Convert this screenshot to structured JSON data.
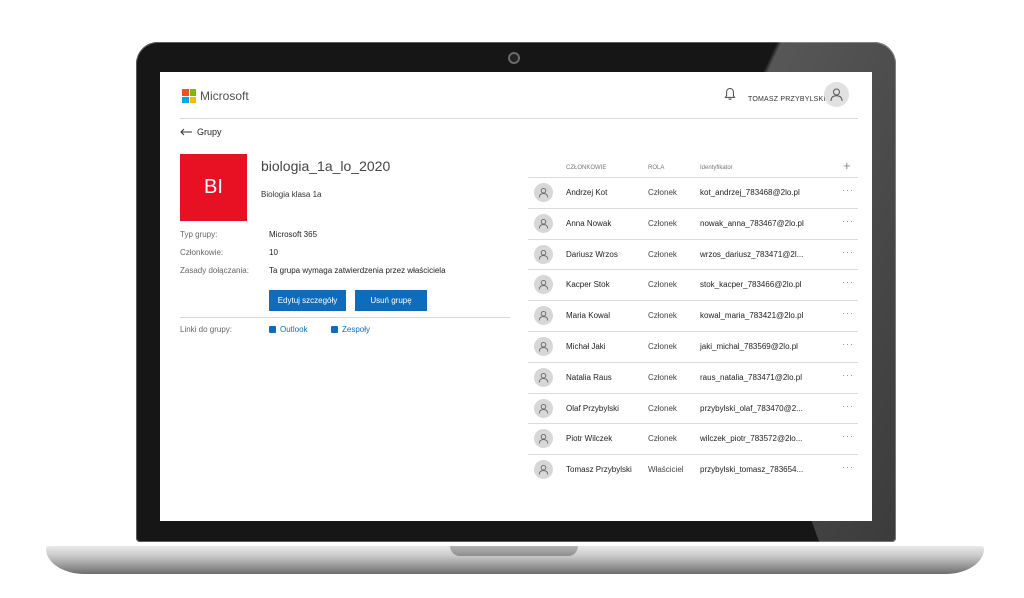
{
  "colors": {
    "accent": "#0f6cbd",
    "tile": "#e81123",
    "ms_red": "#f25022",
    "ms_green": "#7fba00",
    "ms_blue": "#00a4ef",
    "ms_yellow": "#ffb900"
  },
  "header": {
    "brand": "Microsoft",
    "user_name": "TOMASZ PRZYBYLSKI",
    "icons": [
      "bell-icon",
      "user-avatar-icon"
    ]
  },
  "back": {
    "label": "Grupy"
  },
  "group": {
    "initials": "BI",
    "name": "biologia_1a_lo_2020",
    "description": "Biologia klasa 1a",
    "properties": [
      {
        "label": "Typ grupy:",
        "value": "Microsoft 365"
      },
      {
        "label": "Członkowie:",
        "value": "10"
      },
      {
        "label": "Zasady dołączania:",
        "value": "Ta grupa wymaga zatwierdzenia przez właściciela"
      }
    ],
    "edit_label": "Edytuj szczegóły",
    "delete_label": "Usuń grupę",
    "links_label": "Linki do grupy:",
    "links": [
      {
        "label": "Outlook",
        "icon": "outlook-icon"
      },
      {
        "label": "Zespoły",
        "icon": "teams-icon"
      }
    ]
  },
  "members": {
    "columns": [
      "CZŁONKOWIE",
      "ROLA",
      "Identyfikator"
    ],
    "add_icon": "plus-icon",
    "more_label": "···",
    "rows": [
      {
        "name": "Andrzej Kot",
        "role": "Członek",
        "id": "kot_andrzej_783468@2lo.pl"
      },
      {
        "name": "Anna Nowak",
        "role": "Członek",
        "id": "nowak_anna_783467@2lo.pl"
      },
      {
        "name": "Dariusz Wrzos",
        "role": "Członek",
        "id": "wrzos_dariusz_783471@2l..."
      },
      {
        "name": "Kacper Stok",
        "role": "Członek",
        "id": "stok_kacper_783466@2lo.pl"
      },
      {
        "name": "Maria Kowal",
        "role": "Członek",
        "id": "kowal_maria_783421@2lo.pl"
      },
      {
        "name": "Michał Jaki",
        "role": "Członek",
        "id": "jaki_michal_783569@2lo.pl"
      },
      {
        "name": "Natalia Raus",
        "role": "Członek",
        "id": "raus_natalia_783471@2lo.pl"
      },
      {
        "name": "Olaf Przybylski",
        "role": "Członek",
        "id": "przybylski_olaf_783470@2..."
      },
      {
        "name": "Piotr Wilczek",
        "role": "Członek",
        "id": "wilczek_piotr_783572@2lo..."
      },
      {
        "name": "Tomasz Przybylski",
        "role": "Właściciel",
        "id": "przybylski_tomasz_783654..."
      }
    ]
  }
}
